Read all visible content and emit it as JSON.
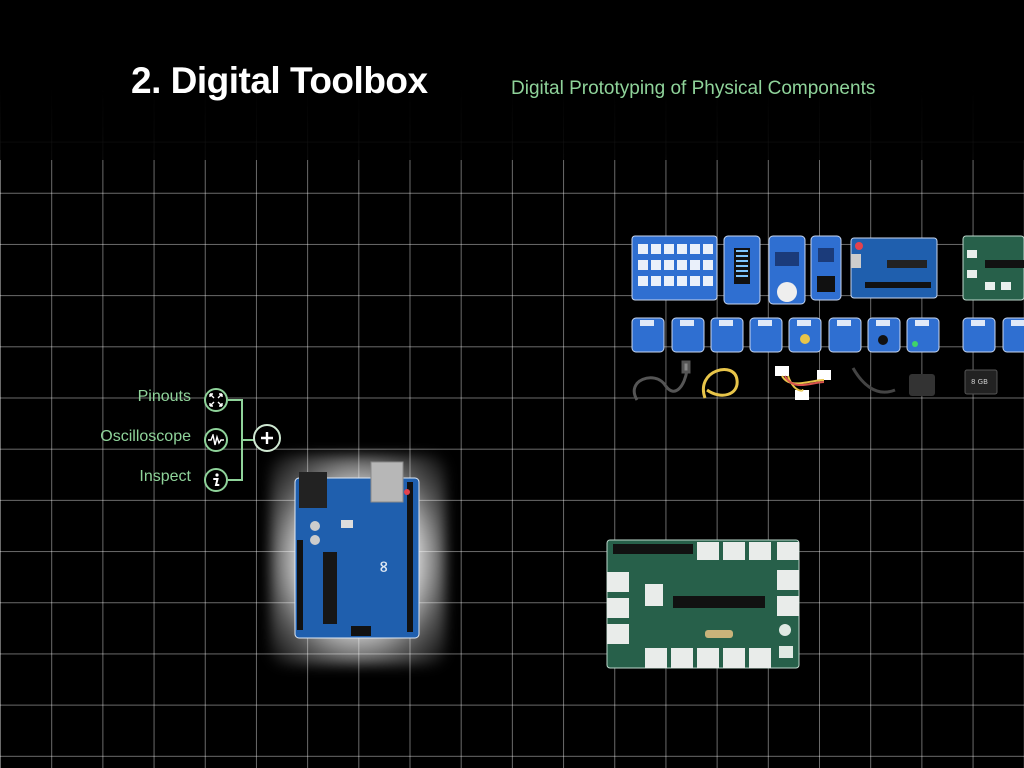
{
  "header": {
    "title": "2. Digital Toolbox",
    "subtitle": "Digital Prototyping of Physical Components"
  },
  "toolbox": {
    "items": [
      {
        "label": "Pinouts",
        "icon": "expand-arrows-icon"
      },
      {
        "label": "Oscilloscope",
        "icon": "waveform-icon"
      },
      {
        "label": "Inspect",
        "icon": "info-icon"
      }
    ],
    "add_icon": "plus-icon"
  },
  "colors": {
    "accent_green": "#8fd39a",
    "arduino_blue": "#1f5fae",
    "grove_blue": "#2f6fd1",
    "hat_green": "#27604a"
  }
}
